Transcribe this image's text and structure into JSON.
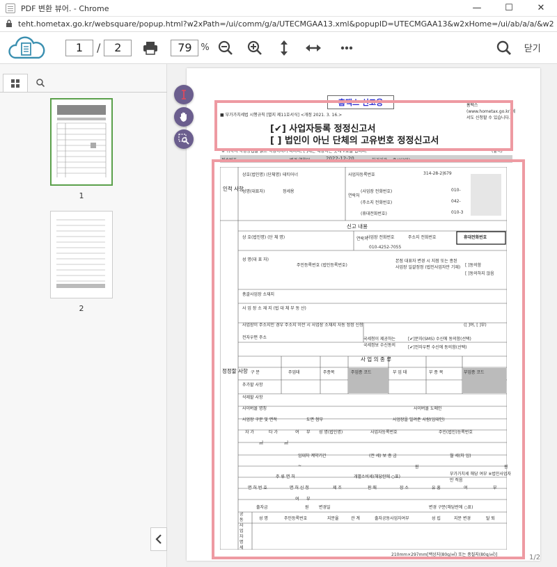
{
  "window": {
    "title": "PDF 변환 뷰어. - Chrome",
    "min": "—",
    "max": "☐",
    "close": "✕"
  },
  "address": {
    "url": "teht.hometax.go.kr/websquare/popup.html?w2xPath=/ui/comm/g/a/UTECMGAA13.xml&popupID=UTECMGAA13&w2xHome=/ui/ab/a/a/&w2xDocu..."
  },
  "toolbar": {
    "current_page": "1",
    "separator": "/",
    "total_pages": "2",
    "zoom": "79",
    "zoom_unit": "%",
    "close_label": "닫기"
  },
  "sidebar": {
    "thumbnails": [
      {
        "label": "1"
      },
      {
        "label": "2"
      }
    ]
  },
  "viewer": {
    "page_indicator": "1/2"
  },
  "document": {
    "stamp": "홈택스 신고용",
    "form_code": "■ 부가가치세법 시행규칙 [별지 제11호서식] <개정 2021. 3. 16.>",
    "note_right": "홈택스(www.hometax.go.kr)에서도 신청할 수 있습니다.",
    "title1": "[✔] 사업자등록 정정신고서",
    "title2": "[ ] 법인이 아닌 단체의 고유번호 정정신고서",
    "instructions": "※ 뒤쪽의 작성방법을 읽고 작성하시기 바라며, [ ]에는 해당하는 곳에 √표를 합니다.",
    "side_label": "(앞쪽)",
    "receipt_no": "접수번호",
    "change_date_label": "변경 연월일",
    "change_date": "2022-12-20",
    "processing": "처리기간",
    "processing_value": "즉시(2일)",
    "section_person": "인적 사항",
    "company_label": "상호(법인명) (단체명)",
    "company_value": "테티어너",
    "bizno_label": "사업자등록번호",
    "bizno_value": "314-28-2|679",
    "rep_label": "성명(대표자)",
    "rep_value": "정세용",
    "contact_label": "연락처",
    "phone1_label": "(사업장 전화번호)",
    "phone1_value": "010-",
    "phone2_label": "(주소지 전화번호)",
    "phone2_value": "042-",
    "phone3_label": "(휴대전화번호)",
    "phone3_value": "010-3",
    "report_content": "신고 내용",
    "section_correction": "정정할 사항",
    "trade_name": "상 호(법인명) (단 체 명)",
    "contact2": "연락처",
    "biz_phone": "사업장 전화번호",
    "addr_phone": "주소지 전화번호",
    "mobile": "휴대전화번호",
    "mobile_value": "010-4252-7055",
    "name_rep": "성 명(대 표 자)",
    "rrn_label": "주민등록번호 (법인등록번호)",
    "hq_change": "본점 대표자 변경 시 지점 또는 종된 사업장 일괄정정 (법인사업자만 기재)",
    "agree": "[ ]동의함",
    "disagree": "[ ]동의하지 않음",
    "hq_location": "총괄사업장 소재지",
    "biz_location": "사 업 장 소 재 지 (법 대 체 부 동 산)",
    "auto_change": "사업장이 주소지인 경우 주소지 이전 시 사업장 소재지 자동 정정 신청",
    "auto_yes_no": "([ ]여, [ ]부)",
    "email_addr": "전자우편 주소",
    "nts_info": "국세청이 제공하는 국세정보 수신동의",
    "sms_agree": "[✔]문자(SMS) 수신에 동의함(선택)",
    "email_agree": "[✔]전자우편 수신에 동의함(선택)",
    "biz_type": "사 업 의 종 류",
    "col_class": "구 분",
    "col_main_type": "주업태",
    "col_main_item": "주종목",
    "col_main_code": "주업종 코드",
    "col_sub_type": "부 업 태",
    "col_sub_item": "부 종 목",
    "col_sub_code": "부업종 코드",
    "row_add": "추가할 사항",
    "row_delete": "삭제할 사항",
    "cyber_mall": "사이버몰 명칭",
    "cyber_domain": "사이버몰 도메인",
    "area": "사업장 구분 및 면적",
    "drawing": "도면 첨부",
    "lender": "사업장을 빌려준 사람(임대인)",
    "own": "자 가",
    "rent": "타 가",
    "yes": "여",
    "no": "부",
    "lender_name": "성 명(법인명)",
    "lender_bizno": "사업자등록번호",
    "lender_rrn": "주민(법인)등록번호",
    "sqm1": "㎡",
    "sqm2": "㎡",
    "lease_period": "임대차 계약기간",
    "deposit": "(전 세) 보 증 금",
    "monthly": "월 세(차 임)",
    "won1": "원",
    "won2": "원",
    "tilde": "~",
    "license_section": "주 류 면 허",
    "excise": "개별소비세(해당란에 ○표)",
    "vat_flag": "부가가치세 해당 여부 ※법인사업자만 적음",
    "license_no": "면 허 번 호",
    "license_apply": "면 허 신 청",
    "manufacture": "제 조",
    "sale": "판 매",
    "place": "장 소",
    "entertain": "유 흥",
    "yes2": "여",
    "no2": "부",
    "yes3": "여",
    "no3": "부",
    "joint_label": "공동사업자 명세",
    "investment": "출자금",
    "won3": "원",
    "change_date2": "변경일",
    "change_type": "변경 구분(해당란에 ○표)",
    "col_name": "성 명",
    "col_rrn": "주민등록번호",
    "col_share": "지분율",
    "col_rel": "관 계",
    "col_joint_date": "출자공동사업자여부",
    "col_est": "성 립",
    "col_share_change": "지분 변경",
    "col_withdraw": "탈 퇴",
    "paper_size": "210mm×297mm[백상지(80g/㎡) 또는 중질지(80g/㎡)]"
  },
  "colors": {
    "highlight": "#ee9aa2",
    "fab": "#6b5e8e",
    "thumb_active": "#5aa04a",
    "logo": "#3a8fb0"
  }
}
